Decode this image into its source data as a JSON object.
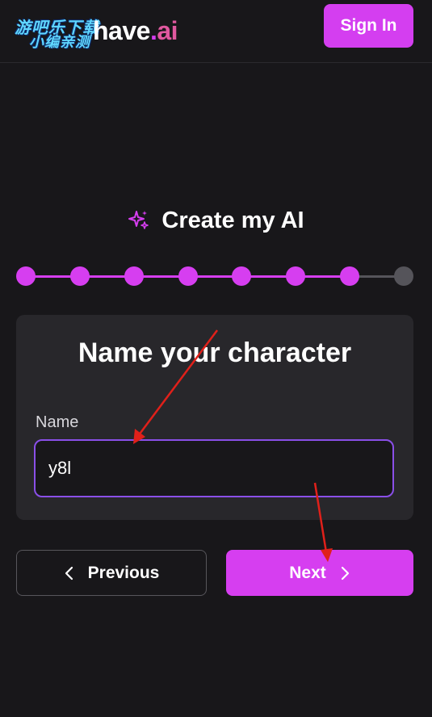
{
  "header": {
    "watermark_line1": "游吧乐下载",
    "watermark_line2": "小编亲测",
    "brand_prefix": "have",
    "brand_dot": ".",
    "brand_suffix": "ai",
    "sign_in_label": "Sign In"
  },
  "page": {
    "title": "Create my AI",
    "sparkle_icon": "sparkles-icon"
  },
  "stepper": {
    "total_steps": 8,
    "completed_steps": 7,
    "active_color": "#d63ef0",
    "inactive_color": "#55545a"
  },
  "card": {
    "heading": "Name your character",
    "name_label": "Name",
    "name_value": "y8l"
  },
  "nav": {
    "previous_label": "Previous",
    "next_label": "Next"
  },
  "colors": {
    "accent": "#d63ef0",
    "background": "#18171a",
    "card": "#28272b",
    "input_border": "#8a4fe8",
    "annotation_arrow": "#e0201a"
  }
}
